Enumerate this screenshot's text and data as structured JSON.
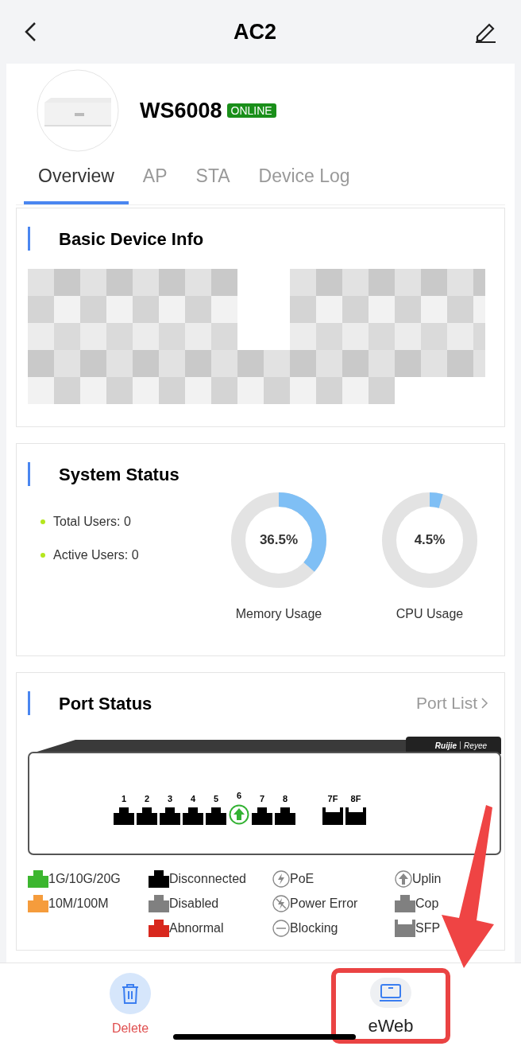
{
  "header": {
    "title": "AC2"
  },
  "device": {
    "model": "WS6008",
    "status": "ONLINE"
  },
  "tabs": [
    {
      "label": "Overview",
      "selected": true
    },
    {
      "label": "AP",
      "selected": false
    },
    {
      "label": "STA",
      "selected": false
    },
    {
      "label": "Device Log",
      "selected": false
    }
  ],
  "basic_info": {
    "title": "Basic Device Info"
  },
  "system_status": {
    "title": "System Status",
    "stats": [
      {
        "label": "Total Users: 0",
        "color": "#b5e61d"
      },
      {
        "label": "Active Users: 0",
        "color": "#b5e61d"
      }
    ],
    "meters": [
      {
        "reading": "36.5%",
        "level": 0.365,
        "label": "Memory Usage"
      },
      {
        "reading": "4.5%",
        "level": 0.045,
        "label": "CPU Usage"
      }
    ]
  },
  "port_status": {
    "title": "Port Status",
    "link": "Port List",
    "brand": [
      "Ruijie",
      "Reyee"
    ],
    "ports": [
      {
        "label": "1",
        "kind": "rj45",
        "uplink": false
      },
      {
        "label": "2",
        "kind": "rj45",
        "uplink": false
      },
      {
        "label": "3",
        "kind": "rj45",
        "uplink": false
      },
      {
        "label": "4",
        "kind": "rj45",
        "uplink": false
      },
      {
        "label": "5",
        "kind": "rj45",
        "uplink": false
      },
      {
        "label": "6",
        "kind": "rj45",
        "uplink": true
      },
      {
        "label": "7",
        "kind": "rj45",
        "uplink": false
      },
      {
        "label": "8",
        "kind": "rj45",
        "uplink": false
      },
      {
        "label": "7F",
        "kind": "sfp",
        "uplink": false
      },
      {
        "label": "8F",
        "kind": "sfp",
        "uplink": false
      }
    ],
    "legend": [
      [
        {
          "label": "1G/10G/20G",
          "kind": "rj45",
          "color": "#3cb62f"
        },
        {
          "label": "10M/100M",
          "kind": "rj45",
          "color": "#f59c3c"
        }
      ],
      [
        {
          "label": "Disconnected",
          "kind": "rj45",
          "color": "#000000"
        },
        {
          "label": "Disabled",
          "kind": "rj45",
          "color": "#808080"
        },
        {
          "label": "Abnormal",
          "kind": "rj45",
          "color": "#d8281e"
        }
      ],
      [
        {
          "label": "PoE",
          "kind": "poe"
        },
        {
          "label": "Power Error",
          "kind": "power-error"
        },
        {
          "label": "Blocking",
          "kind": "blocking"
        }
      ],
      [
        {
          "label": "Uplin",
          "kind": "uplink"
        },
        {
          "label": "Cop",
          "kind": "rj45",
          "color": "#808080"
        },
        {
          "label": "SFP",
          "kind": "sfp",
          "color": "#808080"
        }
      ]
    ]
  },
  "actions": [
    {
      "label": "Delete",
      "kind": "delete"
    },
    {
      "label": "eWeb",
      "kind": "eweb",
      "highlighted": true
    }
  ]
}
